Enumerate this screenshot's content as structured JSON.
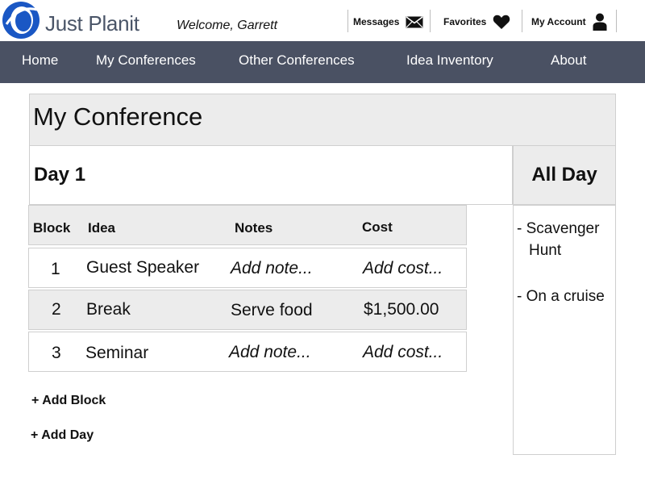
{
  "header": {
    "brand": "Just Planit",
    "welcome": "Welcome, Garrett",
    "links": {
      "messages": "Messages",
      "favorites": "Favorites",
      "account": "My Account"
    },
    "icons": {
      "logo": "globe-logo",
      "messages": "envelope-icon",
      "favorites": "heart-icon",
      "account": "person-icon"
    },
    "colors": {
      "brand_text": "#4a5568",
      "logo_blue": "#1a57c4"
    }
  },
  "nav": {
    "items": [
      "Home",
      "My Conferences",
      "Other Conferences",
      "Idea Inventory",
      "About"
    ],
    "background": "#4a5163"
  },
  "conference": {
    "title": "My Conference",
    "day": {
      "title": "Day 1",
      "columns": [
        "Block",
        "Idea",
        "Notes",
        "Cost"
      ],
      "rows": [
        {
          "block": "1",
          "idea": "Guest Speaker",
          "notes": "Add note...",
          "cost": "Add cost..."
        },
        {
          "block": "2",
          "idea": "Break",
          "notes": "Serve food",
          "cost": "$1,500.00"
        },
        {
          "block": "3",
          "idea": "Seminar",
          "notes": "Add note...",
          "cost": "Add cost..."
        }
      ]
    },
    "all_day": {
      "title": "All Day",
      "items": [
        "- Scavenger",
        "Hunt",
        "- On a cruise"
      ]
    },
    "actions": {
      "add_block": "+ Add Block",
      "add_day": "+ Add Day"
    }
  }
}
